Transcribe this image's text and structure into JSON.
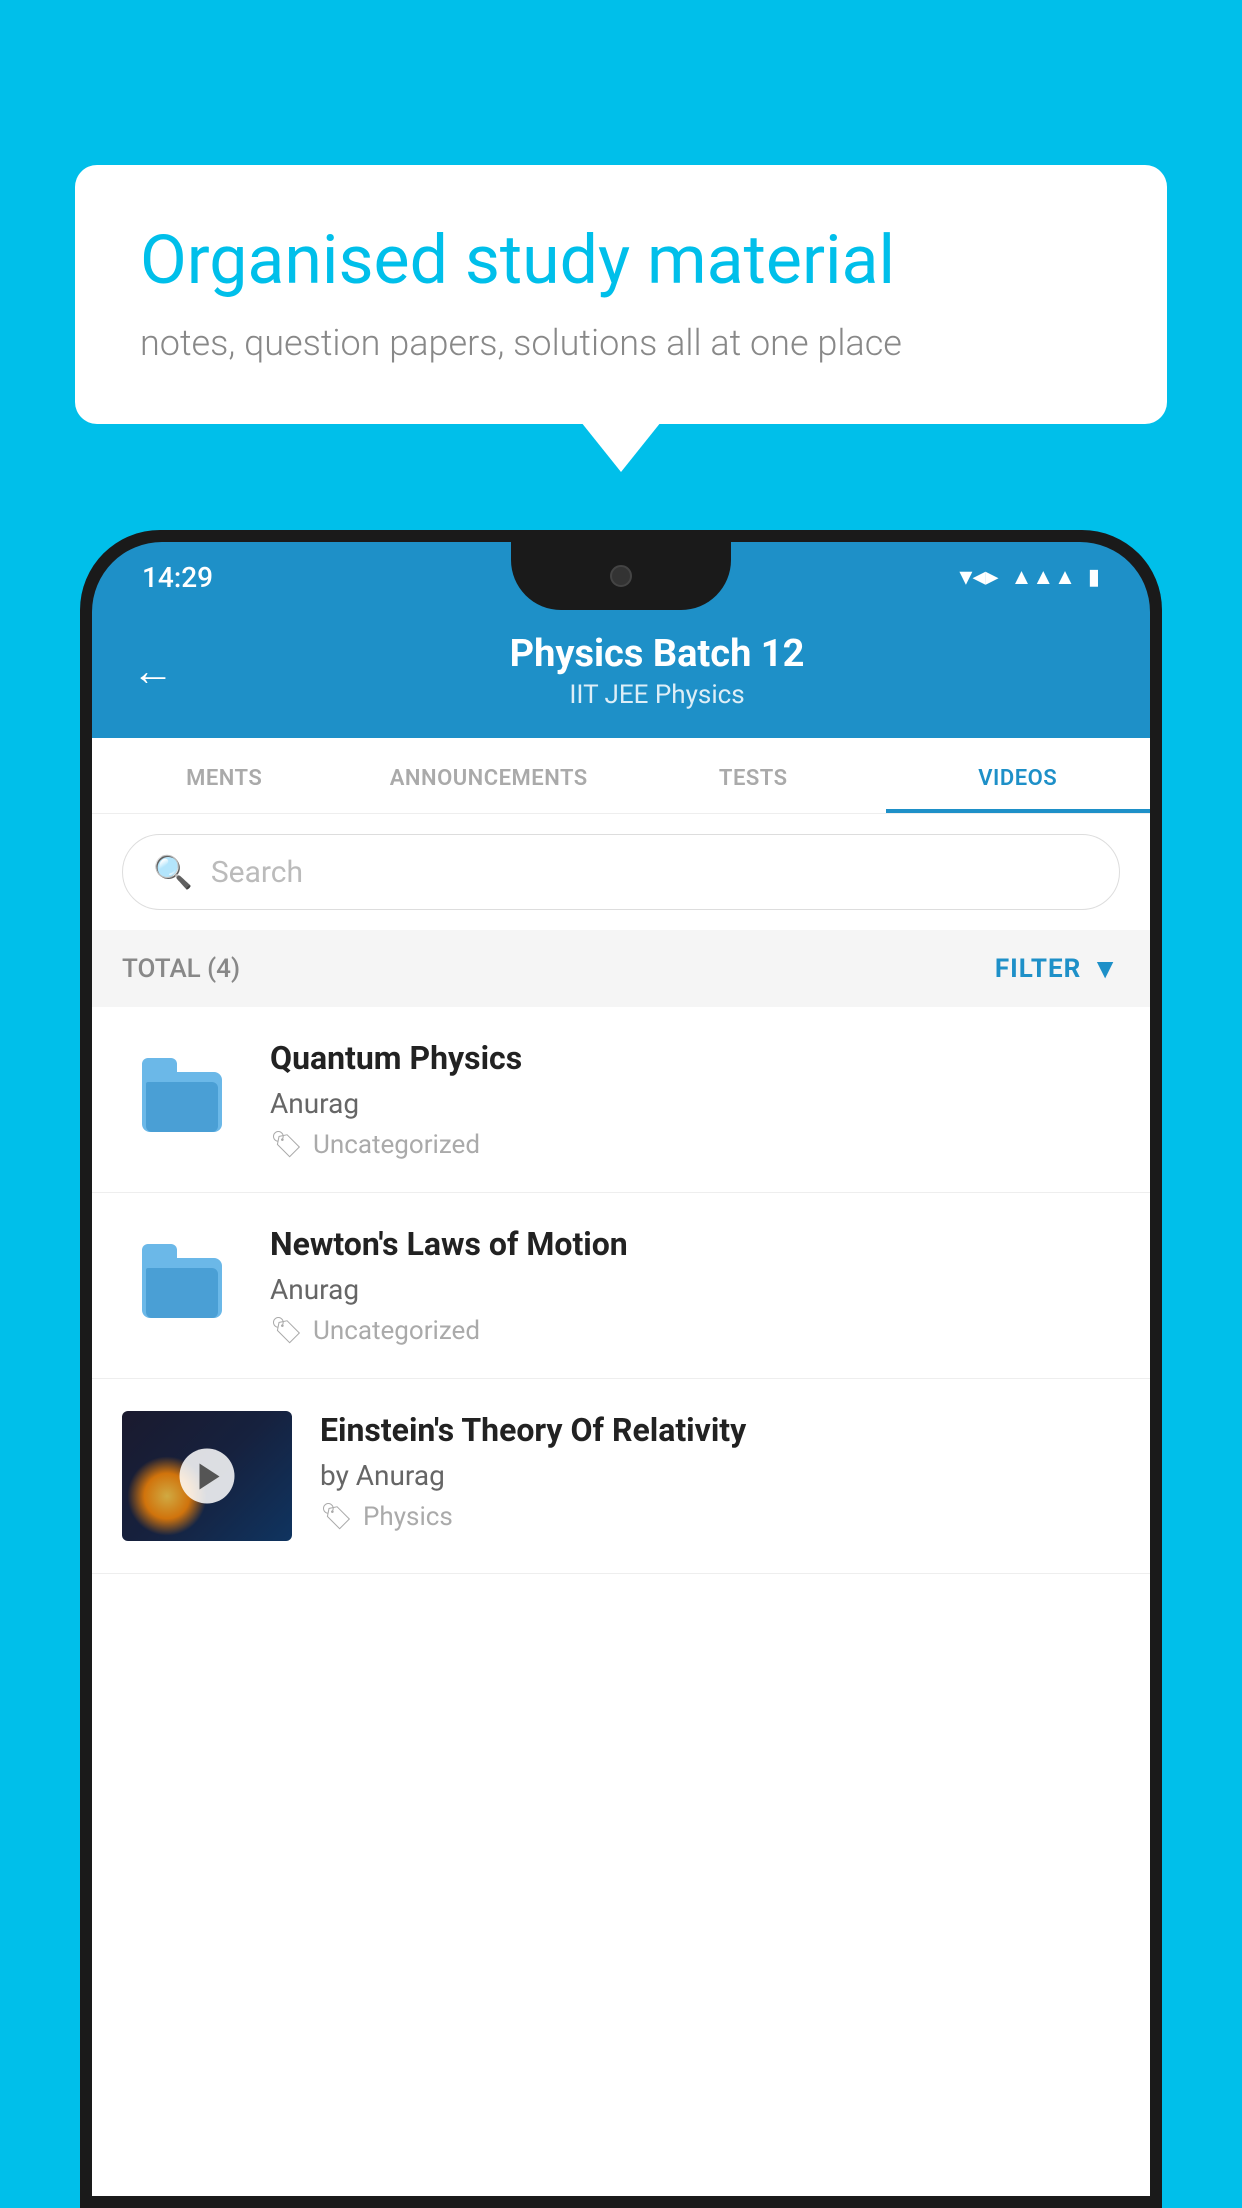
{
  "bubble": {
    "title": "Organised study material",
    "subtitle": "notes, question papers, solutions all at one place"
  },
  "statusBar": {
    "time": "14:29"
  },
  "header": {
    "title": "Physics Batch 12",
    "subtitle": "IIT JEE   Physics",
    "back_label": "←"
  },
  "tabs": [
    {
      "label": "MENTS",
      "active": false
    },
    {
      "label": "ANNOUNCEMENTS",
      "active": false
    },
    {
      "label": "TESTS",
      "active": false
    },
    {
      "label": "VIDEOS",
      "active": true
    }
  ],
  "search": {
    "placeholder": "Search"
  },
  "filterRow": {
    "total": "TOTAL (4)",
    "filter_label": "FILTER"
  },
  "videos": [
    {
      "title": "Quantum Physics",
      "author": "Anurag",
      "tag": "Uncategorized",
      "has_thumb": false
    },
    {
      "title": "Newton's Laws of Motion",
      "author": "Anurag",
      "tag": "Uncategorized",
      "has_thumb": false
    },
    {
      "title": "Einstein's Theory Of Relativity",
      "author": "by Anurag",
      "tag": "Physics",
      "has_thumb": true
    }
  ]
}
